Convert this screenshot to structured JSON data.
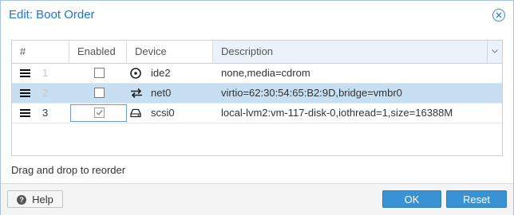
{
  "dialog": {
    "title": "Edit: Boot Order"
  },
  "grid": {
    "headers": {
      "num": "#",
      "enabled": "Enabled",
      "device": "Device",
      "description": "Description"
    },
    "rows": [
      {
        "num": "1",
        "enabled": false,
        "device_icon": "cdrom-icon",
        "device": "ide2",
        "description": "none,media=cdrom",
        "selected": false
      },
      {
        "num": "2",
        "enabled": false,
        "device_icon": "network-icon",
        "device": "net0",
        "description": "virtio=62:30:54:65:B2:9D,bridge=vmbr0",
        "selected": true
      },
      {
        "num": "3",
        "enabled": true,
        "device_icon": "harddisk-icon",
        "device": "scsi0",
        "description": "local-lvm2:vm-117-disk-0,iothread=1,size=16388M",
        "selected": false
      }
    ]
  },
  "hint": "Drag and drop to reorder",
  "footer": {
    "help_label": "Help",
    "ok_label": "OK",
    "reset_label": "Reset"
  },
  "colors": {
    "accent": "#3892d4",
    "title": "#1a76d2",
    "selected_row": "#c6dff2"
  }
}
